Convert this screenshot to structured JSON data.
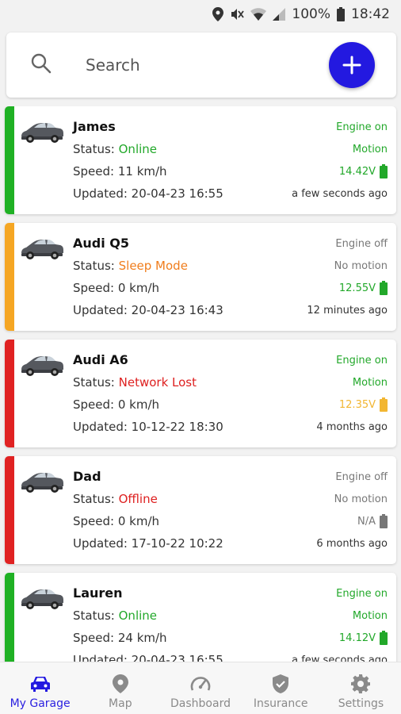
{
  "statusbar": {
    "battery_percent": "100%",
    "time": "18:42"
  },
  "search": {
    "placeholder": "Search"
  },
  "colors": {
    "accent": "#2319e0",
    "online": "#22a82a",
    "sleep": "#f07d1c",
    "lost": "#de2020",
    "offline": "#de2020",
    "muted": "#777777",
    "amber": "#f2b632"
  },
  "vehicles": [
    {
      "name": "James",
      "status_label": "Status: ",
      "status": "Online",
      "speed": "Speed: 11 km/h",
      "updated": "Updated: 20-04-23 16:55",
      "engine": "Engine on",
      "motion": "Motion",
      "voltage": "14.42V",
      "ago": "a few seconds ago",
      "bar_color": "#1fb124",
      "status_color": "#22a82a",
      "engine_color": "#22a82a",
      "motion_color": "#22a82a",
      "volt_color": "#22a82a"
    },
    {
      "name": "Audi Q5",
      "status_label": "Status: ",
      "status": "Sleep Mode",
      "speed": "Speed: 0 km/h",
      "updated": "Updated: 20-04-23 16:43",
      "engine": "Engine off",
      "motion": "No motion",
      "voltage": "12.55V",
      "ago": "12 minutes ago",
      "bar_color": "#f5a623",
      "status_color": "#f07d1c",
      "engine_color": "#777777",
      "motion_color": "#777777",
      "volt_color": "#22a82a"
    },
    {
      "name": "Audi A6",
      "status_label": "Status: ",
      "status": "Network Lost",
      "speed": "Speed: 0 km/h",
      "updated": "Updated: 10-12-22 18:30",
      "engine": "Engine on",
      "motion": "Motion",
      "voltage": "12.35V",
      "ago": "4 months ago",
      "bar_color": "#e02222",
      "status_color": "#de2020",
      "engine_color": "#22a82a",
      "motion_color": "#22a82a",
      "volt_color": "#f2b632"
    },
    {
      "name": "Dad",
      "status_label": "Status: ",
      "status": "Offline",
      "speed": "Speed: 0 km/h",
      "updated": "Updated: 17-10-22 10:22",
      "engine": "Engine off",
      "motion": "No motion",
      "voltage": "N/A",
      "ago": "6 months ago",
      "bar_color": "#e02222",
      "status_color": "#de2020",
      "engine_color": "#777777",
      "motion_color": "#777777",
      "volt_color": "#777777"
    },
    {
      "name": "Lauren",
      "status_label": "Status: ",
      "status": "Online",
      "speed": "Speed: 24 km/h",
      "updated": "Updated: 20-04-23 16:55",
      "engine": "Engine on",
      "motion": "Motion",
      "voltage": "14.12V",
      "ago": "a few seconds ago",
      "bar_color": "#1fb124",
      "status_color": "#22a82a",
      "engine_color": "#22a82a",
      "motion_color": "#22a82a",
      "volt_color": "#22a82a"
    }
  ],
  "nav": [
    {
      "label": "My Garage",
      "icon": "car-icon",
      "active": true
    },
    {
      "label": "Map",
      "icon": "map-pin-icon",
      "active": false
    },
    {
      "label": "Dashboard",
      "icon": "speedometer-icon",
      "active": false
    },
    {
      "label": "Insurance",
      "icon": "shield-check-icon",
      "active": false
    },
    {
      "label": "Settings",
      "icon": "gear-icon",
      "active": false
    }
  ]
}
